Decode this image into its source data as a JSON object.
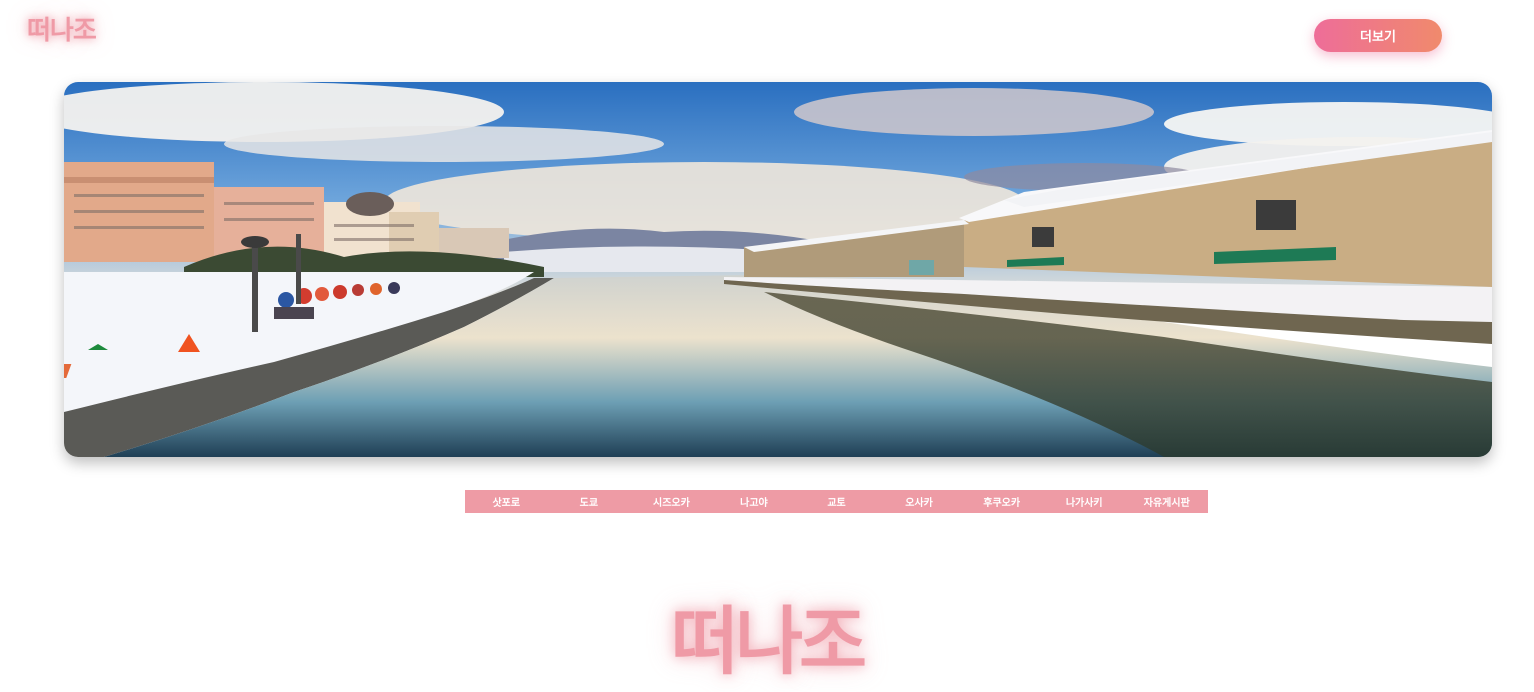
{
  "header": {
    "logo": "떠나조",
    "more_button": "더보기"
  },
  "hero": {
    "image": "snowy-canal-photo"
  },
  "nav": {
    "items": [
      "삿포로",
      "도쿄",
      "시즈오카",
      "나고야",
      "교토",
      "오사카",
      "후쿠오카",
      "나가사키",
      "자유게시판"
    ]
  },
  "footer": {
    "logo": "떠나조"
  },
  "colors": {
    "brand_pink": "#ef9aa6",
    "nav_bg": "#ee9ba5",
    "button_gradient_start": "#ee6d99",
    "button_gradient_end": "#f08a6c"
  }
}
